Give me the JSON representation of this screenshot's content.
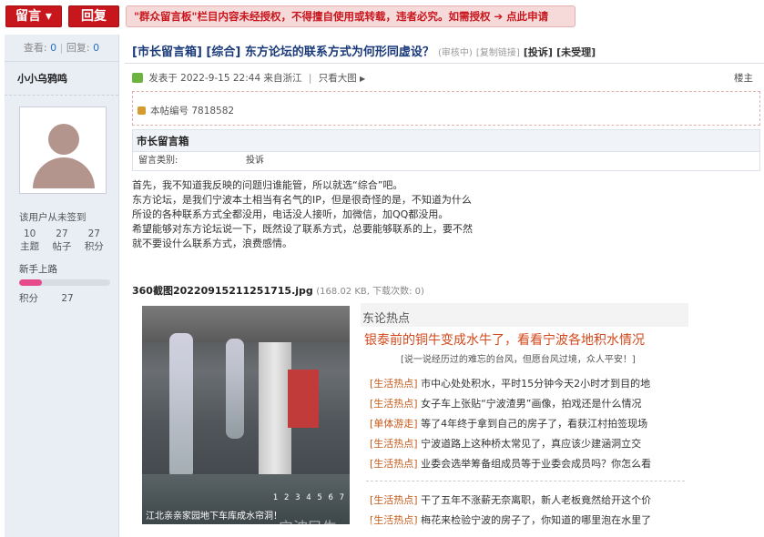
{
  "topbar": {
    "post_label": "留言 ▾",
    "reply_label": "回复",
    "notice": "\"群众留言板\"栏目内容未经授权，不得擅自使用或转载，违者必究。如需授权",
    "apply_label": "➔ 点此申请"
  },
  "sidebar": {
    "views_label": "查看:",
    "views": "0",
    "replies_label": "回复:",
    "replies": "0",
    "username": "小小乌鸦鸣",
    "sign_note": "该用户从未签到",
    "stats": [
      {
        "value": "10",
        "label": "主题"
      },
      {
        "value": "27",
        "label": "帖子"
      },
      {
        "value": "27",
        "label": "积分"
      }
    ],
    "level_name": "新手上路",
    "level_progress": 0.25,
    "score_label": "积分",
    "score": "27"
  },
  "post": {
    "title": "[市长留言箱] [综合] 东方论坛的联系方式为何形同虚设？",
    "review": "(审核中)",
    "copy_link": "[复制链接]",
    "complaint": "[投诉]",
    "status": "[未受理]",
    "meta": "发表于 2022-9-15 22:44 来自浙江",
    "sep": "|",
    "view_large": "只看大图",
    "floor": "楼主",
    "post_id": "本帖编号 7818582",
    "box_title": "市长留言箱",
    "category_label": "留言类别:",
    "category": "投诉",
    "content": [
      "首先，我不知道我反映的问题归谁能管，所以就选“综合”吧。",
      "东方论坛，是我们宁波本土相当有名气的IP，但是很奇怪的是，不知道为什么",
      "所设的各种联系方式全都没用，电话没人接听，加微信，加QQ都没用。",
      "希望能够对东方论坛说一下，既然设了联系方式，总要能够联系的上，要不然",
      "就不要设什么联系方式，浪费感情。"
    ],
    "attachment_name": "360截图20220915211251715.jpg",
    "attachment_meta": "(168.02 KB, 下载次数: 0)"
  },
  "image": {
    "photo_caption": "江北亲亲家园地下车库成水帘洞！",
    "photo_pages": "1 2 3 4 5 6 7",
    "section_title": "东论热点",
    "headline": "银泰前的铜牛变成水牛了，看看宁波各地积水情况",
    "subline": "[说一说经历过的难忘的台风，但愿台风过境，众人平安！]",
    "items": [
      {
        "tag": "[生活热点]",
        "text": "市中心处处积水，平时15分钟今天2小时才到目的地"
      },
      {
        "tag": "[生活热点]",
        "text": "女子车上张贴“宁波渣男”画像，拍戏还是什么情况"
      },
      {
        "tag": "[单体游走]",
        "text": "等了4年终于拿到自己的房子了，看获江村拍签现场"
      },
      {
        "tag": "[生活热点]",
        "text": "宁波道路上这种桥太常见了，真应该少建涵洞立交"
      },
      {
        "tag": "[生活热点]",
        "text": "业委会选举筹备组成员等于业委会成员吗？你怎么看"
      },
      {
        "tag": "[生活热点]",
        "text": "干了五年不涨薪无奈离职，新人老板竟然给开这个价"
      },
      {
        "tag": "[生活热点]",
        "text": "梅花来检验宁波的房子了，你知道的哪里泡在水里了"
      }
    ],
    "watermark": "宁波民生e点通-天一论坛"
  }
}
